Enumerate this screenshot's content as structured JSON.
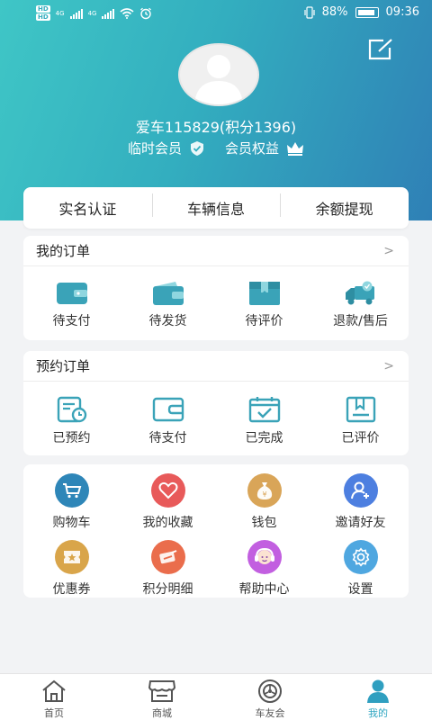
{
  "status_bar": {
    "network_badge_1": "HD",
    "network_badge_2": "HD",
    "signal_1_label": "4G",
    "signal_2_label": "4G",
    "battery": "88%",
    "time": "09:36"
  },
  "profile": {
    "username": "爱车115829(积分1396)",
    "member_level": "临时会员",
    "member_benefits": "会员权益"
  },
  "quick_actions": [
    "实名认证",
    "车辆信息",
    "余额提现"
  ],
  "my_orders": {
    "title": "我的订单",
    "arrow": ">",
    "items": [
      {
        "label": "待支付",
        "icon": "wallet-icon"
      },
      {
        "label": "待发货",
        "icon": "purse-icon"
      },
      {
        "label": "待评价",
        "icon": "package-icon"
      },
      {
        "label": "退款/售后",
        "icon": "delivery-truck-icon"
      }
    ]
  },
  "booking_orders": {
    "title": "预约订单",
    "arrow": ">",
    "items": [
      {
        "label": "已预约",
        "icon": "clock-document-icon"
      },
      {
        "label": "待支付",
        "icon": "wallet-outline-icon"
      },
      {
        "label": "已完成",
        "icon": "calendar-check-icon"
      },
      {
        "label": "已评价",
        "icon": "bookmark-document-icon"
      }
    ]
  },
  "services": [
    {
      "label": "购物车",
      "icon": "shopping-cart-icon",
      "color": "#2e86b8"
    },
    {
      "label": "我的收藏",
      "icon": "heart-icon",
      "color": "#e85a5a"
    },
    {
      "label": "钱包",
      "icon": "money-bag-icon",
      "color": "#d9a558"
    },
    {
      "label": "邀请好友",
      "icon": "add-user-icon",
      "color": "#4d7fe0"
    },
    {
      "label": "优惠券",
      "icon": "coupon-icon",
      "color": "#d9a54a"
    },
    {
      "label": "积分明细",
      "icon": "points-icon",
      "color": "#ea6d4c"
    },
    {
      "label": "帮助中心",
      "icon": "help-avatar-icon",
      "color": "#c25fe0"
    },
    {
      "label": "设置",
      "icon": "settings-gear-icon",
      "color": "#4fa7e0"
    }
  ],
  "tabbar": [
    {
      "label": "首页",
      "icon": "home-icon",
      "active": false
    },
    {
      "label": "商城",
      "icon": "store-icon",
      "active": false
    },
    {
      "label": "车友会",
      "icon": "wheel-icon",
      "active": false
    },
    {
      "label": "我的",
      "icon": "user-profile-icon",
      "active": true
    }
  ],
  "colors": {
    "header_gradient_start": "#3fc6c6",
    "header_gradient_end": "#2f80b6",
    "accent": "#2fa6c1",
    "icon_teal": "#3aa3b8"
  }
}
